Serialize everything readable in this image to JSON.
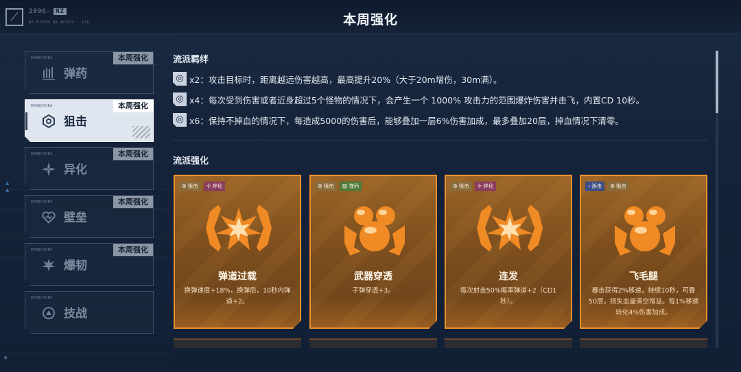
{
  "header": {
    "title": "本周强化",
    "logo_code": "2096-",
    "logo_badge": "NZ",
    "logo_sub": "NZ FUTURE NA 963975 - 17A"
  },
  "sidebar": {
    "badge_text": "本周强化",
    "tab_code": "DMQNOYONA",
    "items": [
      {
        "label": "弹药",
        "icon": "ammo-bars-icon",
        "badge": true,
        "active": false
      },
      {
        "label": "狙击",
        "icon": "crosshair-icon",
        "badge": true,
        "active": true
      },
      {
        "label": "异化",
        "icon": "mutation-icon",
        "badge": true,
        "active": false
      },
      {
        "label": "壁垒",
        "icon": "shield-heart-icon",
        "badge": true,
        "active": false
      },
      {
        "label": "爆韧",
        "icon": "burst-icon",
        "badge": true,
        "active": false
      },
      {
        "label": "技战",
        "icon": "tactics-icon",
        "badge": false,
        "active": false
      }
    ]
  },
  "bonds": {
    "title": "流派羁绊",
    "items": [
      {
        "icon": "bond-icon",
        "text": "x2：攻击目标时，距离越远伤害越高，最高提升20%（大于20m增伤，30m满）。"
      },
      {
        "icon": "bond-icon",
        "text": "x4：每次受到伤害或者近身超过5个怪物的情况下，会产生一个 1000% 攻击力的范围爆炸伤害并击飞，内置CD 10秒。"
      },
      {
        "icon": "bond-icon",
        "text": "x6：保持不掉血的情况下，每造成5000的伤害后，能够叠加一层6%伤害加成，最多叠加20层，掉血情况下清零。"
      }
    ]
  },
  "enhance": {
    "title": "流派强化",
    "cards": [
      {
        "name": "弹道过载",
        "desc": "换弹速度+18%，换弹后，10秒内弹道+2。",
        "emblem": "star-burst-emblem",
        "tags": [
          {
            "label": "狙击",
            "kind": "snipe"
          },
          {
            "label": "异化",
            "kind": "mut"
          }
        ]
      },
      {
        "name": "武器穿透",
        "desc": "子弹穿透+3。",
        "emblem": "orbs-emblem",
        "tags": [
          {
            "label": "狙击",
            "kind": "snipe"
          },
          {
            "label": "弹药",
            "kind": "ammo"
          }
        ]
      },
      {
        "name": "连发",
        "desc": "每次射击50%概率弹道+2（CD1秒）。",
        "emblem": "star-burst-emblem",
        "tags": [
          {
            "label": "狙击",
            "kind": "snipe"
          },
          {
            "label": "异化",
            "kind": "mut"
          }
        ]
      },
      {
        "name": "飞毛腿",
        "desc": "暴击获得2%移速，持续10秒，可叠50层，损失血量清空增益。每1%移速转化4%伤害加成。",
        "emblem": "orbs-emblem",
        "tags": [
          {
            "label": "游击",
            "kind": "bolt"
          },
          {
            "label": "狙击",
            "kind": "snipe"
          }
        ]
      }
    ]
  },
  "scroll_fraction_visible": 0.21,
  "colors": {
    "accent_orange": "#f0912e",
    "card_fill": "#7e4f1e",
    "background": "#16233a",
    "active_tab": "#dfe6ef"
  }
}
